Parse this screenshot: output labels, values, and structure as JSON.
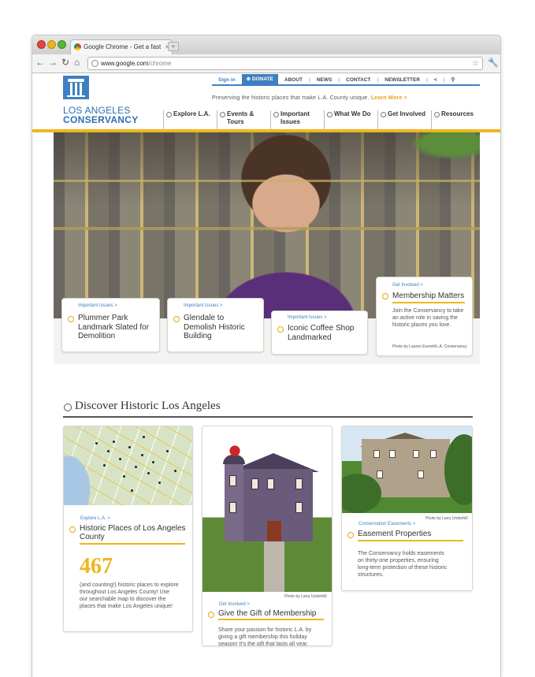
{
  "browser": {
    "tab_title": "Google Chrome - Get a fast",
    "url_host": "www.google.com",
    "url_path": "/chrome",
    "new_tab_glyph": "+",
    "tab_close_glyph": "×",
    "back_glyph": "←",
    "forward_glyph": "→",
    "reload_glyph": "↻",
    "home_glyph": "⌂",
    "star_glyph": "☆",
    "wrench_glyph": "🔧"
  },
  "site": {
    "logo_line1": "LOS ANGELES",
    "logo_line2": "CONSERVANCY",
    "util_nav": {
      "sign_in": "Sign in",
      "donate": "⊕ DONATE",
      "about": "ABOUT",
      "news": "NEWS",
      "contact": "CONTACT",
      "newsletter": "NEWSLETTER",
      "share_glyph": "<",
      "search_glyph": "⚲",
      "sep": "|"
    },
    "tagline": "Preserving the historic places that make L.A. County unique.",
    "learn_more": "Learn More >",
    "main_nav": [
      {
        "label": "Explore L.A."
      },
      {
        "label": "Events & Tours"
      },
      {
        "label": "Important Issues"
      },
      {
        "label": "What We Do"
      },
      {
        "label": "Get Involved"
      },
      {
        "label": "Resources"
      }
    ],
    "colors": {
      "brand_blue": "#3f7fc1",
      "accent_gold": "#f0b61d"
    }
  },
  "hero_cards": [
    {
      "kicker": "Important Issues >",
      "title": "Plummer Park Landmark Slated for Demolition"
    },
    {
      "kicker": "Important Issues >",
      "title": "Glendale to Demolish Historic Building"
    },
    {
      "kicker": "Important Issues >",
      "title": "Iconic Coffee Shop Landmarked"
    },
    {
      "kicker": "Get Involved >",
      "title": "Membership Matters",
      "desc": "Join the Conservancy to take an active role in saving the historic places you love.",
      "credit": "Photo by Lauren Everett/L.A. Conservancy"
    }
  ],
  "discover": {
    "title": "Discover Historic Los Angeles",
    "tiles": [
      {
        "kicker": "Explore L.A. >",
        "title": "Historic Places of Los Angeles County",
        "number": "467",
        "desc": "(and counting!) historic places to explore throughout Los Angeles County! Use our searchable map to discover the places that make Los Angeles unique!"
      },
      {
        "kicker": "Get Involved >",
        "title": "Give the Gift of Membership",
        "credit": "Photo by Larry Underhill",
        "desc": "Share your passion for historic L.A. by giving a gift membership this holiday season! It's the gift that lasts all year."
      },
      {
        "kicker": "Conservation Easements >",
        "title": "Easement Properties",
        "credit": "Photo by Larry Underhill",
        "desc": "The Conservancy holds easements on thirty-one properties, ensuring long-term protection of these historic structures."
      }
    ]
  }
}
